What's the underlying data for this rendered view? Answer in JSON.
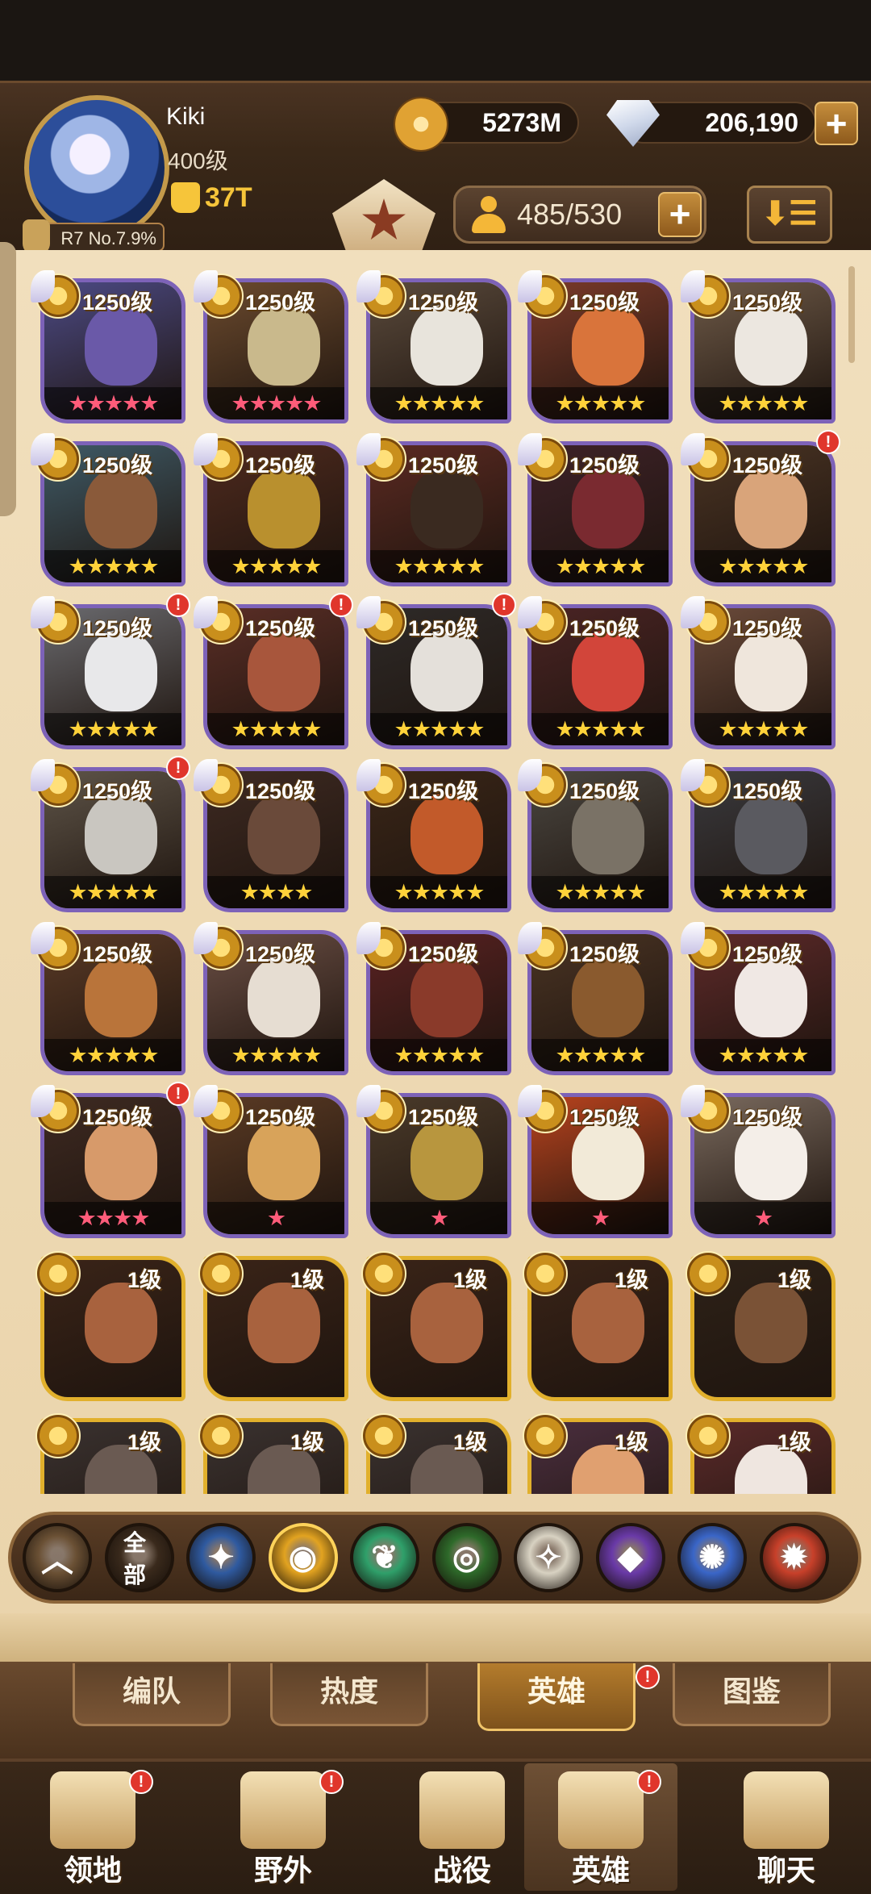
{
  "player": {
    "name": "Kiki",
    "level": "400级",
    "rank_badge": "R7 No.7.9%",
    "power": "37T"
  },
  "resources": {
    "gold": "5273M",
    "diamonds": "206,190"
  },
  "hero_count": "485/530",
  "heroes": [
    {
      "level": "1250级",
      "stars": "★★★★★",
      "star_color": "#ff5c7a",
      "frame": "purple",
      "alert": false,
      "bg": "#4c4a84",
      "face": "#6a59a8"
    },
    {
      "level": "1250级",
      "stars": "★★★★★",
      "star_color": "#ff5c7a",
      "frame": "purple",
      "alert": false,
      "bg": "#6b4a2e",
      "face": "#c9b98c"
    },
    {
      "level": "1250级",
      "stars": "★★★★★",
      "star_color": "#ffd23a",
      "frame": "purple",
      "alert": false,
      "bg": "#5a4a3c",
      "face": "#e8e4dc"
    },
    {
      "level": "1250级",
      "stars": "★★★★★",
      "star_color": "#ffd23a",
      "frame": "purple",
      "alert": false,
      "bg": "#7a3a2a",
      "face": "#d9743b"
    },
    {
      "level": "1250级",
      "stars": "★★★★★",
      "star_color": "#ffd23a",
      "frame": "purple",
      "alert": false,
      "bg": "#6e5a48",
      "face": "#ece7e0"
    },
    {
      "level": "1250级",
      "stars": "★★★★★",
      "star_color": "#ffd23a",
      "frame": "purple",
      "alert": false,
      "bg": "#3f5a66",
      "face": "#8a5a3a"
    },
    {
      "level": "1250级",
      "stars": "★★★★★",
      "star_color": "#ffd23a",
      "frame": "purple",
      "alert": false,
      "bg": "#4e2a1e",
      "face": "#b9902e"
    },
    {
      "level": "1250级",
      "stars": "★★★★★",
      "star_color": "#ffd23a",
      "frame": "purple",
      "alert": false,
      "bg": "#5b2a22",
      "face": "#3a2a20"
    },
    {
      "level": "1250级",
      "stars": "★★★★★",
      "star_color": "#ffd23a",
      "frame": "purple",
      "alert": false,
      "bg": "#3e2228",
      "face": "#7a2a30"
    },
    {
      "level": "1250级",
      "stars": "★★★★★",
      "star_color": "#ffd23a",
      "frame": "purple",
      "alert": true,
      "bg": "#4a3424",
      "face": "#d9a47a"
    },
    {
      "level": "1250级",
      "stars": "★★★★★",
      "star_color": "#ffd23a",
      "frame": "purple",
      "alert": true,
      "bg": "#6a6a6e",
      "face": "#e8e8ea"
    },
    {
      "level": "1250级",
      "stars": "★★★★★",
      "star_color": "#ffd23a",
      "frame": "purple",
      "alert": true,
      "bg": "#5a2e26",
      "face": "#a8563c"
    },
    {
      "level": "1250级",
      "stars": "★★★★★",
      "star_color": "#ffd23a",
      "frame": "purple",
      "alert": true,
      "bg": "#2e2a28",
      "face": "#e4e0da"
    },
    {
      "level": "1250级",
      "stars": "★★★★★",
      "star_color": "#ffd23a",
      "frame": "purple",
      "alert": false,
      "bg": "#4a2424",
      "face": "#d2453a"
    },
    {
      "level": "1250级",
      "stars": "★★★★★",
      "star_color": "#ffd23a",
      "frame": "purple",
      "alert": false,
      "bg": "#6a4a3a",
      "face": "#efe6dc"
    },
    {
      "level": "1250级",
      "stars": "★★★★★",
      "star_color": "#ffd23a",
      "frame": "purple",
      "alert": true,
      "bg": "#5e5448",
      "face": "#c9c6c0"
    },
    {
      "level": "1250级",
      "stars": "★★★★",
      "star_color": "#ffd23a",
      "frame": "purple",
      "alert": false,
      "bg": "#3e2a22",
      "face": "#6a4a3a"
    },
    {
      "level": "1250级",
      "stars": "★★★★★",
      "star_color": "#ffd23a",
      "frame": "purple",
      "alert": false,
      "bg": "#3a2618",
      "face": "#c25a2a"
    },
    {
      "level": "1250级",
      "stars": "★★★★★",
      "star_color": "#ffd23a",
      "frame": "purple",
      "alert": false,
      "bg": "#4a4640",
      "face": "#7a7266"
    },
    {
      "level": "1250级",
      "stars": "★★★★★",
      "star_color": "#ffd23a",
      "frame": "purple",
      "alert": false,
      "bg": "#3a3a3e",
      "face": "#5a5a60"
    },
    {
      "level": "1250级",
      "stars": "★★★★★",
      "star_color": "#ffd23a",
      "frame": "purple",
      "alert": false,
      "bg": "#5a3a26",
      "face": "#b9743a"
    },
    {
      "level": "1250级",
      "stars": "★★★★★",
      "star_color": "#ffd23a",
      "frame": "purple",
      "alert": false,
      "bg": "#6a4e44",
      "face": "#e6ddd2"
    },
    {
      "level": "1250级",
      "stars": "★★★★★",
      "star_color": "#ffd23a",
      "frame": "purple",
      "alert": false,
      "bg": "#5a2222",
      "face": "#8a3a2a"
    },
    {
      "level": "1250级",
      "stars": "★★★★★",
      "star_color": "#ffd23a",
      "frame": "purple",
      "alert": false,
      "bg": "#4a3424",
      "face": "#8a5a2e"
    },
    {
      "level": "1250级",
      "stars": "★★★★★",
      "star_color": "#ffd23a",
      "frame": "purple",
      "alert": false,
      "bg": "#5e2a2a",
      "face": "#f0e8e4"
    },
    {
      "level": "1250级",
      "stars": "★★★★",
      "star_color": "#ff5c7a",
      "frame": "purple",
      "alert": true,
      "bg": "#3e2a22",
      "face": "#d79a6a"
    },
    {
      "level": "1250级",
      "stars": "★",
      "star_color": "#ff5c7a",
      "frame": "purple",
      "alert": false,
      "bg": "#5a3a24",
      "face": "#d8a35a"
    },
    {
      "level": "1250级",
      "stars": "★",
      "star_color": "#ff5c7a",
      "frame": "purple",
      "alert": false,
      "bg": "#4a3a2a",
      "face": "#b8963e"
    },
    {
      "level": "1250级",
      "stars": "★",
      "star_color": "#ff5c7a",
      "frame": "purple",
      "alert": false,
      "bg": "#b8431e",
      "face": "#f2ead8"
    },
    {
      "level": "1250级",
      "stars": "★",
      "star_color": "#ff5c7a",
      "frame": "purple",
      "alert": false,
      "bg": "#7a6a5e",
      "face": "#f4eee8"
    },
    {
      "level": "1级",
      "stars": "",
      "star_color": "#ffd23a",
      "frame": "gold",
      "alert": false,
      "bg": "#3a2418",
      "face": "#a8623e"
    },
    {
      "level": "1级",
      "stars": "",
      "star_color": "#ffd23a",
      "frame": "gold",
      "alert": false,
      "bg": "#3a2418",
      "face": "#a8623e"
    },
    {
      "level": "1级",
      "stars": "",
      "star_color": "#ffd23a",
      "frame": "gold",
      "alert": false,
      "bg": "#3a2418",
      "face": "#a8623e"
    },
    {
      "level": "1级",
      "stars": "",
      "star_color": "#ffd23a",
      "frame": "gold",
      "alert": false,
      "bg": "#3a2418",
      "face": "#a8623e"
    },
    {
      "level": "1级",
      "stars": "",
      "star_color": "#ffd23a",
      "frame": "gold",
      "alert": false,
      "bg": "#2e2218",
      "face": "#7a5236"
    },
    {
      "level": "1级",
      "stars": "",
      "star_color": "#ffd23a",
      "frame": "gold",
      "alert": false,
      "bg": "#3a3230",
      "face": "#6a5a52"
    },
    {
      "level": "1级",
      "stars": "",
      "star_color": "#ffd23a",
      "frame": "gold",
      "alert": false,
      "bg": "#3a3230",
      "face": "#6a5a52"
    },
    {
      "level": "1级",
      "stars": "",
      "star_color": "#ffd23a",
      "frame": "gold",
      "alert": false,
      "bg": "#3a3230",
      "face": "#6a5a52"
    },
    {
      "level": "1级",
      "stars": "",
      "star_color": "#ffd23a",
      "frame": "gold",
      "alert": false,
      "bg": "#4a2e3e",
      "face": "#e0a070"
    },
    {
      "level": "1级",
      "stars": "",
      "star_color": "#ffd23a",
      "frame": "gold",
      "alert": false,
      "bg": "#5a2a2a",
      "face": "#efe6e0"
    }
  ],
  "factions": [
    {
      "name": "collapse",
      "label": "",
      "color": "#6a5034",
      "glyph": "︿"
    },
    {
      "name": "all",
      "label": "全部",
      "color": "#3a2a1c",
      "glyph": ""
    },
    {
      "name": "lightbearer",
      "label": "",
      "color": "#2f5aa0",
      "glyph": "✦"
    },
    {
      "name": "mauler",
      "label": "",
      "color": "#e2a320",
      "glyph": "◉"
    },
    {
      "name": "wilder",
      "label": "",
      "color": "#2fa06a",
      "glyph": "❦"
    },
    {
      "name": "graveborn",
      "label": "",
      "color": "#2e6a2a",
      "glyph": "◎"
    },
    {
      "name": "celestial",
      "label": "",
      "color": "#d8d2c2",
      "glyph": "✧"
    },
    {
      "name": "hypogean",
      "label": "",
      "color": "#6a3aa8",
      "glyph": "◆"
    },
    {
      "name": "dimensional",
      "label": "",
      "color": "#3a66c8",
      "glyph": "✺"
    },
    {
      "name": "fire",
      "label": "",
      "color": "#c8402a",
      "glyph": "✹"
    }
  ],
  "tabs": [
    {
      "label": "编队",
      "active": false,
      "alert": false
    },
    {
      "label": "热度",
      "active": false,
      "alert": false
    },
    {
      "label": "英雄",
      "active": true,
      "alert": true
    },
    {
      "label": "图鉴",
      "active": false,
      "alert": false
    }
  ],
  "nav": [
    {
      "label": "领地",
      "alert": true,
      "active": false
    },
    {
      "label": "野外",
      "alert": true,
      "active": false
    },
    {
      "label": "战役",
      "alert": false,
      "active": false
    },
    {
      "label": "英雄",
      "alert": true,
      "active": true
    },
    {
      "label": "聊天",
      "alert": false,
      "active": false
    }
  ],
  "alert_mark": "!",
  "plus": "+",
  "sort_glyph": "⬇☰"
}
